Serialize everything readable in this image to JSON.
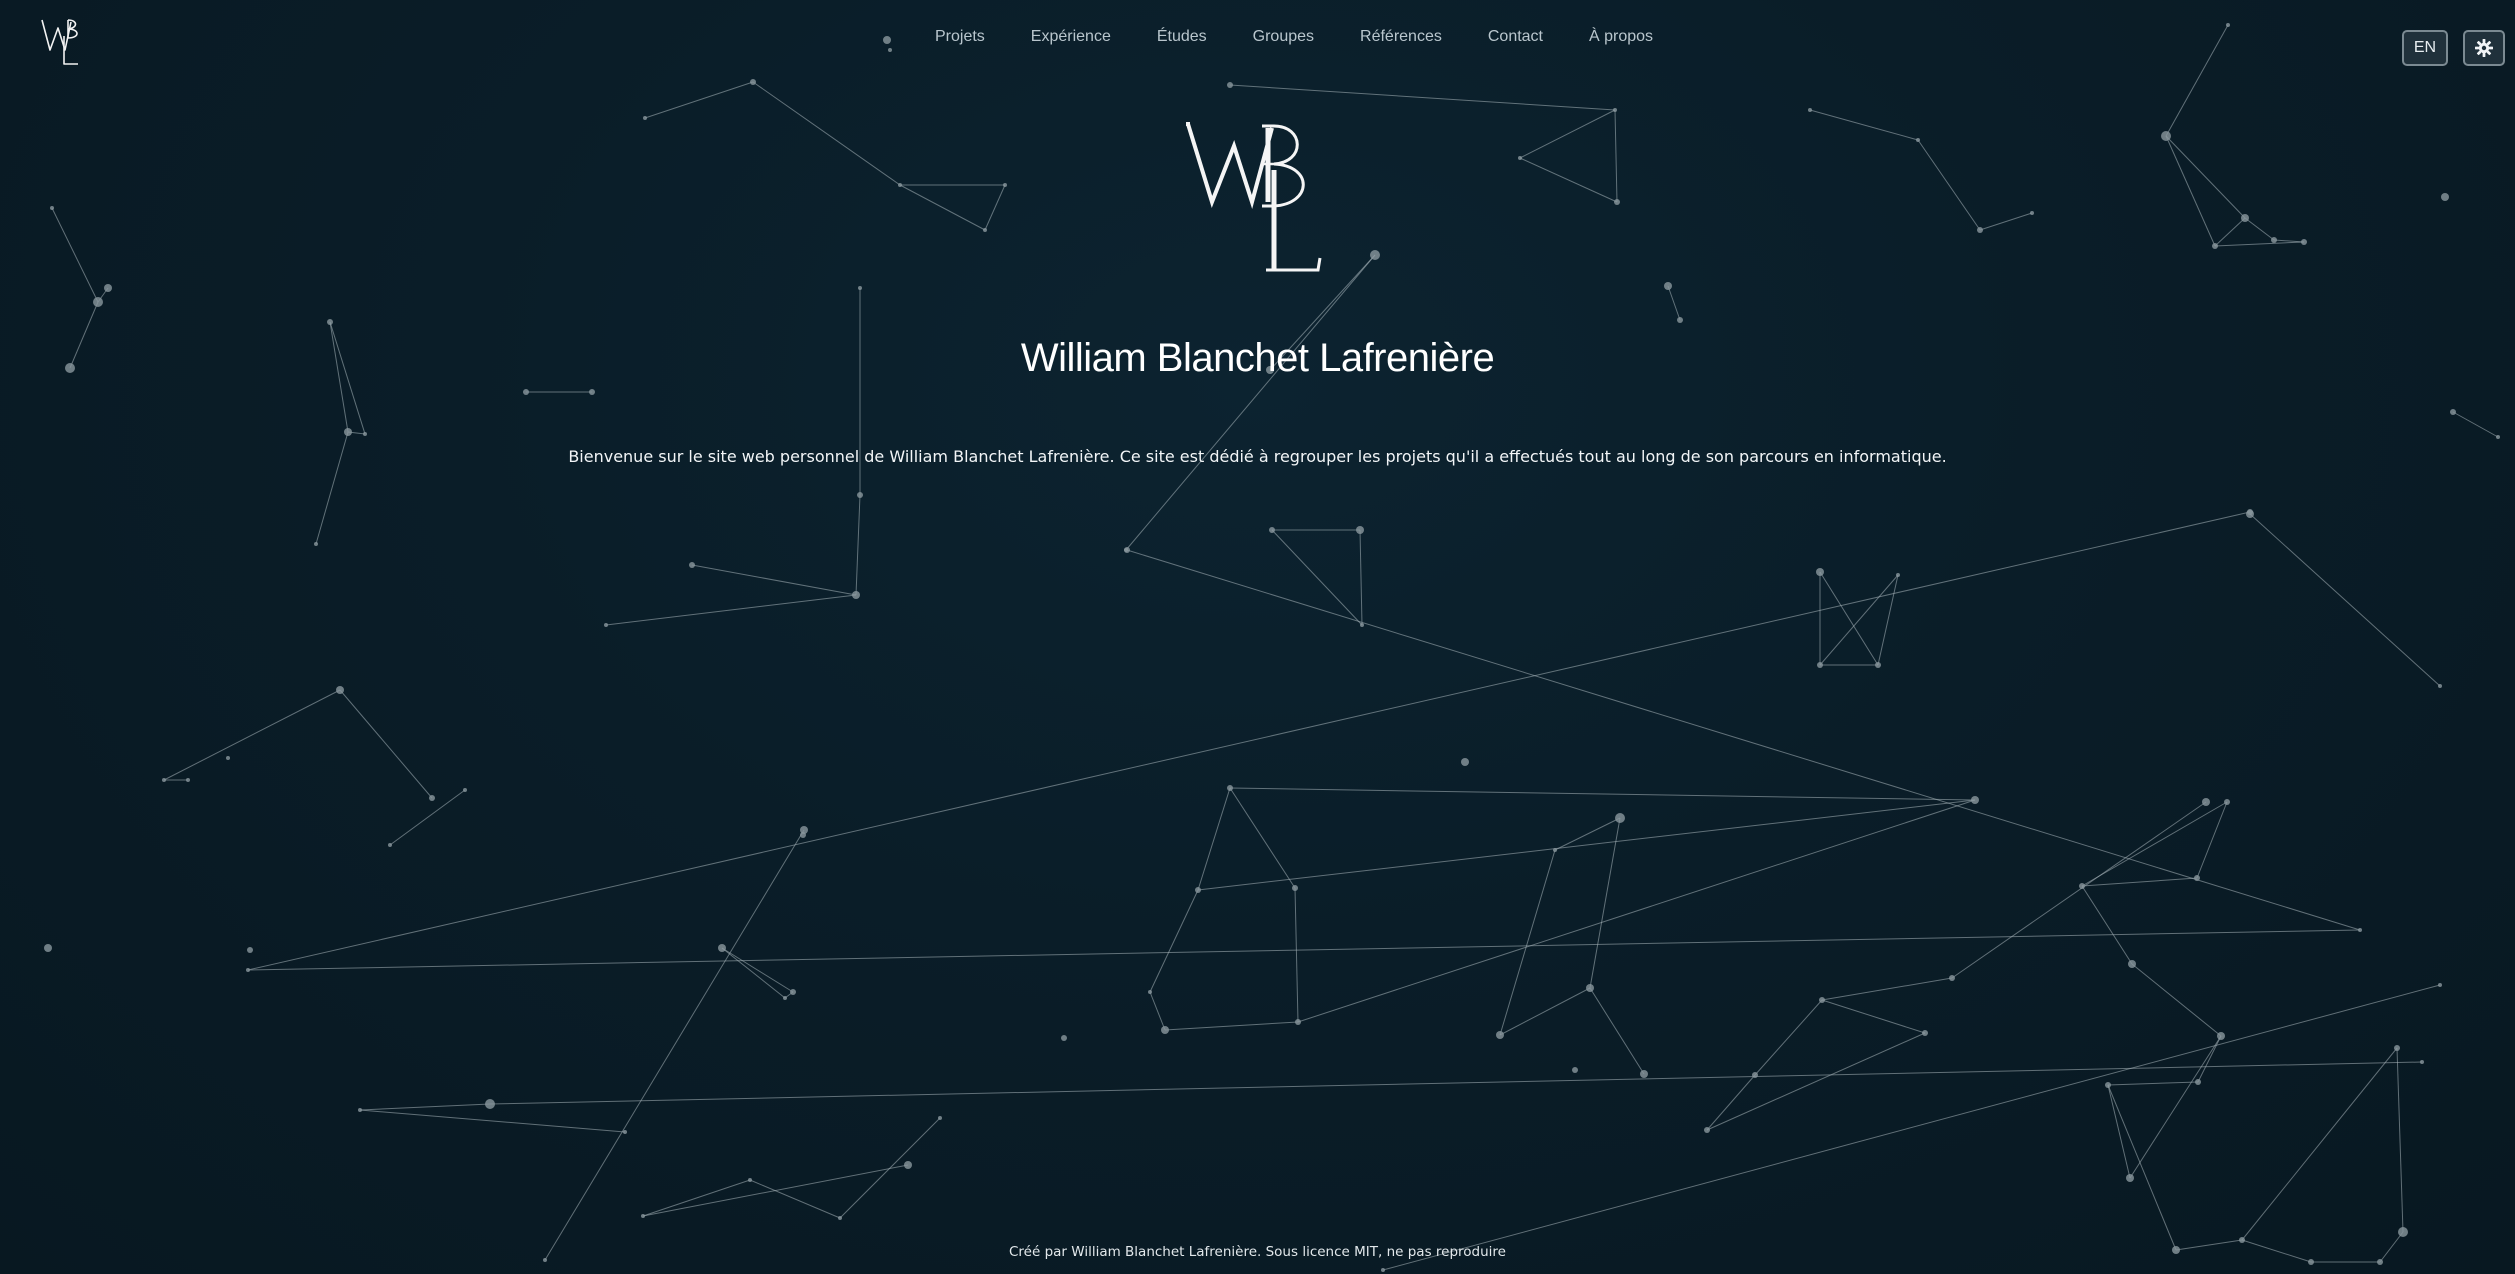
{
  "logo": {
    "initials": "WBL"
  },
  "nav": {
    "items": [
      {
        "label": "Projets"
      },
      {
        "label": "Expérience"
      },
      {
        "label": "Études"
      },
      {
        "label": "Groupes"
      },
      {
        "label": "Références"
      },
      {
        "label": "Contact"
      },
      {
        "label": "À propos"
      }
    ]
  },
  "controls": {
    "language_label": "EN",
    "theme_icon": "gear-icon"
  },
  "hero": {
    "title": "William Blanchet Lafrenière",
    "description": "Bienvenue sur le site web personnel de William Blanchet Lafrenière. Ce site est dédié à regrouper les projets qu'il a effectués tout au long de son parcours en informatique."
  },
  "footer": {
    "text": "Créé par William Blanchet Lafrenière. Sous licence MIT, ne pas reproduire"
  },
  "colors": {
    "background": "#0a1d28",
    "node": "#8a979d",
    "line": "#a9b6bc",
    "text": "#ffffff"
  }
}
